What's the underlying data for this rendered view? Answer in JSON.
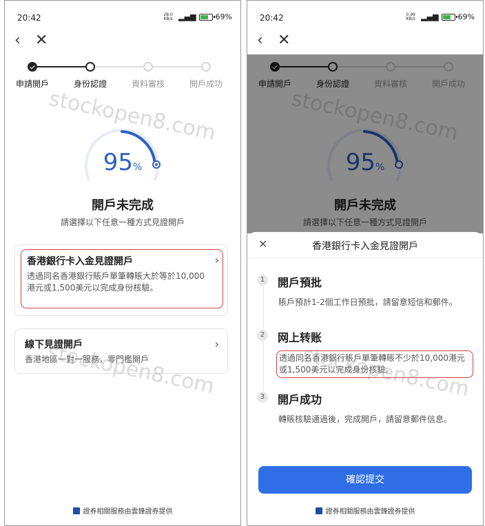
{
  "statusbar": {
    "time": "20:42",
    "net_left": "28.0 KB/s",
    "net_right": "0.99 KB/s",
    "battery": "69%"
  },
  "stepper": {
    "steps": [
      "申請開戶",
      "身份認證",
      "資料審核",
      "開戶成功"
    ]
  },
  "watermark": "stockopen8.com",
  "progress": {
    "value": "95",
    "unit": "%",
    "fraction": 0.95
  },
  "status": {
    "title": "開戶未完成",
    "subtitle": "請選擇以下任意一種方式見證開戶"
  },
  "options": [
    {
      "title": "香港銀行卡入金見證開戶",
      "desc": "透過同名香港銀行賬戶單筆轉賬大於等於10,000港元或1,500美元以完成身份核驗。"
    },
    {
      "title": "線下見證開戶",
      "desc": "香港地區一對一服務，零門檻開戶"
    }
  ],
  "sheet": {
    "title": "香港銀行卡入金見證開戶",
    "steps": [
      {
        "num": "1",
        "title": "開戶預批",
        "desc": "賬戶預計1-2個工作日預批，請留意短信和郵件。"
      },
      {
        "num": "2",
        "title": "网上转账",
        "desc": "透過同名香港銀行賬戶單筆轉賬不少於10,000港元或1,500美元以完成身份核驗。"
      },
      {
        "num": "3",
        "title": "開戶成功",
        "desc": "轉賬核驗通過後，完成開戶，請留意郵件信息。"
      }
    ],
    "confirm_label": "確認提交"
  },
  "footer": "證券相關服務由雲鋒證券提供",
  "colors": {
    "accent": "#2f6ee6",
    "highlight": "#d04040",
    "gauge": "#2f5fc4"
  }
}
